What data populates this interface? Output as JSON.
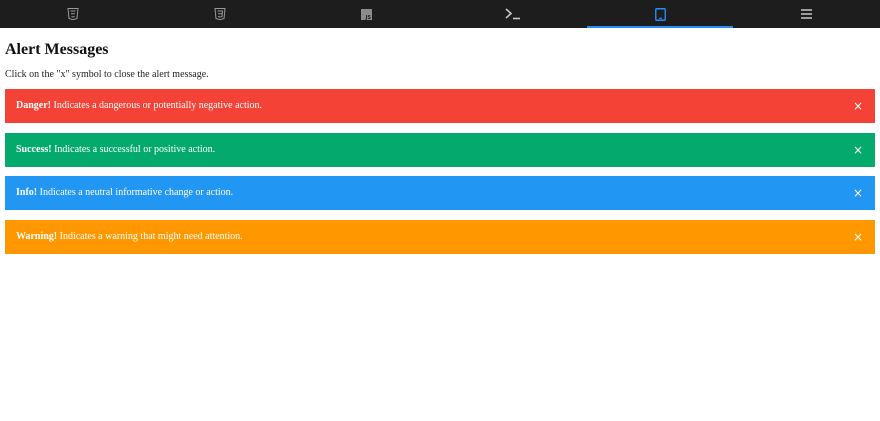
{
  "toolbar": {
    "tabs": [
      {
        "icon": "html5-icon",
        "active": false
      },
      {
        "icon": "css3-icon",
        "active": false
      },
      {
        "icon": "javascript-icon",
        "active": false
      },
      {
        "icon": "terminal-icon",
        "active": false
      },
      {
        "icon": "tablet-preview-icon",
        "active": true
      },
      {
        "icon": "hamburger-menu-icon",
        "active": false
      }
    ],
    "colors": {
      "background": "#1d1d1d",
      "active_indicator": "#2a8af6"
    }
  },
  "page": {
    "title": "Alert Messages",
    "intro": "Click on the \"x\" symbol to close the alert message."
  },
  "alerts": [
    {
      "strong": "Danger!",
      "text": " Indicates a dangerous or potentially negative action.",
      "close": "×",
      "color": "#f44336"
    },
    {
      "strong": "Success!",
      "text": " Indicates a successful or positive action.",
      "close": "×",
      "color": "#04aa6d"
    },
    {
      "strong": "Info!",
      "text": " Indicates a neutral informative change or action.",
      "close": "×",
      "color": "#2196f3"
    },
    {
      "strong": "Warning!",
      "text": " Indicates a warning that might need attention.",
      "close": "×",
      "color": "#ff9800"
    }
  ]
}
